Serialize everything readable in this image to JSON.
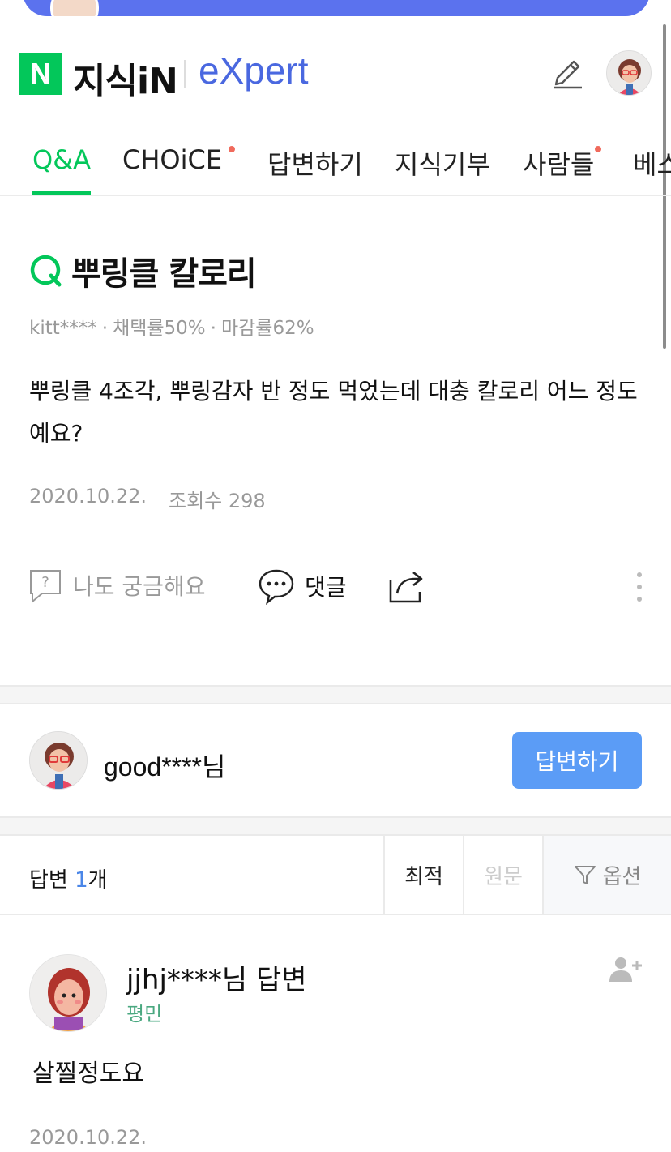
{
  "header": {
    "logo_letter": "N",
    "brand": "지식iN",
    "expert": "eXpert"
  },
  "tabs": [
    {
      "label": "Q&A",
      "active": true,
      "new": false
    },
    {
      "label": "CHOiCE",
      "active": false,
      "new": true
    },
    {
      "label": "답변하기",
      "active": false,
      "new": false
    },
    {
      "label": "지식기부",
      "active": false,
      "new": false
    },
    {
      "label": "사람들",
      "active": false,
      "new": true
    },
    {
      "label": "베스",
      "active": false,
      "new": false
    }
  ],
  "question": {
    "title": "뿌링클 칼로리",
    "author": "kitt****",
    "adopt_rate": "채택률50%",
    "close_rate": "마감률62%",
    "body": "뿌링클 4조각, 뿌링감자 반 정도 먹었는데 대충 칼로리 어느 정도예요?",
    "date": "2020.10.22.",
    "views": "조회수 298"
  },
  "actions": {
    "curious": "나도 궁금해요",
    "comment": "댓글"
  },
  "answer_prompt": {
    "user": "good****님",
    "button": "답변하기"
  },
  "sortbar": {
    "count_prefix": "답변 ",
    "count_num": "1",
    "count_suffix": "개",
    "best": "최적",
    "original": "원문",
    "options": "옵션"
  },
  "answer": {
    "user": "jjhj****님 답변",
    "rank": "평민",
    "body": "살찔정도요",
    "date": "2020.10.22."
  },
  "colors": {
    "green": "#03c75a",
    "blue_button": "#5b9cf6",
    "expert_blue": "#4a68e0",
    "new_dot": "#f06a5c"
  }
}
